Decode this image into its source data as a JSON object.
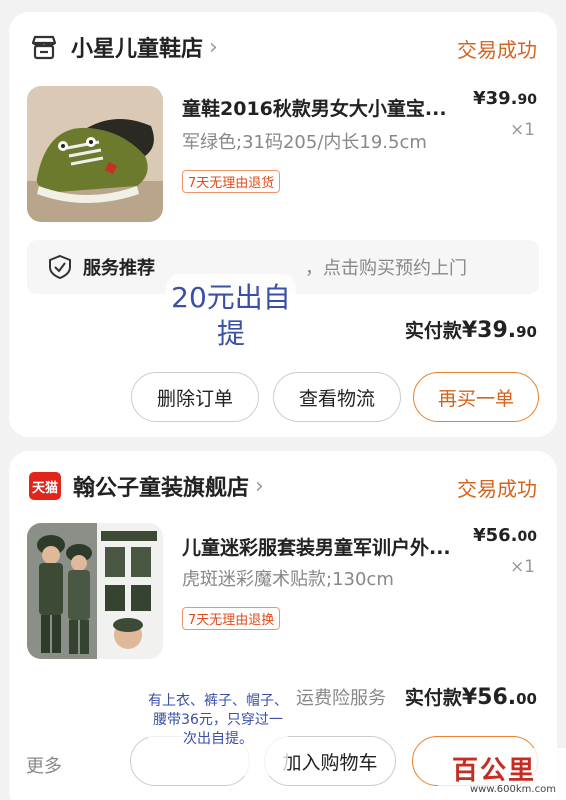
{
  "orders": [
    {
      "shop_name": "小星儿童鞋店",
      "status": "交易成功",
      "item": {
        "title": "童鞋2016秋款男女大小童宝...",
        "price_main": "¥39.",
        "price_cents": "90",
        "qty": "×1",
        "spec": "军绿色;31码205/内长19.5cm",
        "tag": "7天无理由退货"
      },
      "service": {
        "label": "服务推荐",
        "desc": "，点击购买预约上门"
      },
      "paid": {
        "label": "实付款",
        "amount": "¥39.",
        "cents": "90"
      },
      "buttons": [
        "删除订单",
        "查看物流",
        "再买一单"
      ],
      "note": "20元出自提"
    },
    {
      "shop_name": "翰公子童装旗舰店",
      "shop_badge": "天猫",
      "status": "交易成功",
      "item": {
        "title": "儿童迷彩服套装男童军训户外...",
        "price_main": "¥56.",
        "price_cents": "00",
        "qty": "×1",
        "spec": "虎斑迷彩魔术贴款;130cm",
        "tag": "7天无理由退换"
      },
      "insurance_text": "运费险服务",
      "paid": {
        "label": "实付款",
        "amount": "¥56.",
        "cents": "00"
      },
      "more": "更多",
      "buttons": [
        "加入购物车"
      ],
      "note": "有上衣、裤子、帽子、腰带36元，只穿过一次出自提。"
    }
  ],
  "watermark": {
    "title": "百公里",
    "url": "www.600km.com"
  },
  "colors": {
    "accent": "#d5641f",
    "note": "#3a4fa8",
    "tmall": "#e1251b"
  }
}
